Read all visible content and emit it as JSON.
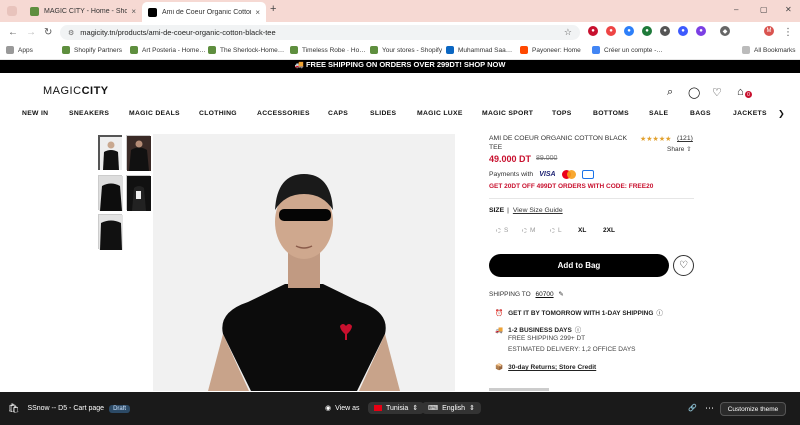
{
  "browser": {
    "tabs": [
      {
        "title": "MAGIC CITY - Home - Shopify",
        "close": "×"
      },
      {
        "title": "Ami de Coeur Organic Cotton B",
        "close": "×"
      }
    ],
    "new_tab": "+",
    "window_controls": [
      "–",
      "▢",
      "✕"
    ],
    "url": "magicity.tn/products/ami-de-coeur-organic-cotton-black-tee",
    "bookmarks": [
      "Apps",
      "Shopify Partners",
      "Art Posteria - Home…",
      "The Sherlock-Home…",
      "Timeless Robe · Ho…",
      "Your stores - Shopify",
      "Muhammad Saa…",
      "Payoneer: Home",
      "Créer un compte -…"
    ],
    "all_bookmarks": "All Bookmarks",
    "profile_initial": "M"
  },
  "promo_banner": "🚚 FREE SHIPPING ON ORDERS OVER 299DT! SHOP NOW",
  "header": {
    "logo_magic": "MAGIC",
    "logo_city": "CITY",
    "cart_count": "0"
  },
  "nav": [
    "NEW IN",
    "SNEAKERS",
    "MAGIC DEALS",
    "CLOTHING",
    "ACCESSORIES",
    "CAPS",
    "SLIDES",
    "MAGIC LUXE",
    "MAGIC SPORT",
    "TOPS",
    "BOTTOMS",
    "SALE",
    "BAGS",
    "JACKETS"
  ],
  "nav_next": "❯",
  "product": {
    "title": "AMI DE COEUR ORGANIC COTTON BLACK TEE",
    "stars": "★★★★★",
    "review_count": "(121)",
    "share": "Share ⇧",
    "price": "49.000 DT",
    "old_price": "89.000",
    "payments_label": "Payments with",
    "visa": "VISA",
    "promo_code": "GET 20DT OFF 499DT ORDERS WITH CODE: FREE20",
    "size_label": "SIZE",
    "size_guide": "View Size Guide",
    "sizes": [
      "S",
      "M",
      "L",
      "XL",
      "2XL"
    ],
    "add_to_bag": "Add to Bag",
    "wishlist": "♡",
    "shipping_to": "SHIPPING TO",
    "shipping_zip": "60700",
    "delivery_line1": "GET IT BY TOMORROW WITH 1-DAY SHIPPING",
    "delivery_days": "1-2 BUSINESS DAYS",
    "free_shipping": "FREE SHIPPING 299+ DT",
    "estimated": "ESTIMATED DELIVERY: 1,2 OFFICE DAYS",
    "returns": "30-day Returns; Store Credit"
  },
  "shopify_bar": {
    "theme": "SSnow -- D5 - Cart page",
    "draft": "Draft",
    "view_as": "View as",
    "country": "Tunisia",
    "language": "English",
    "customize": "Customize theme"
  },
  "colors": {
    "accent_red": "#c8102e",
    "black": "#000000",
    "tab_bar": "#f6d9d3",
    "shopify_bar": "#1a1a1a"
  }
}
